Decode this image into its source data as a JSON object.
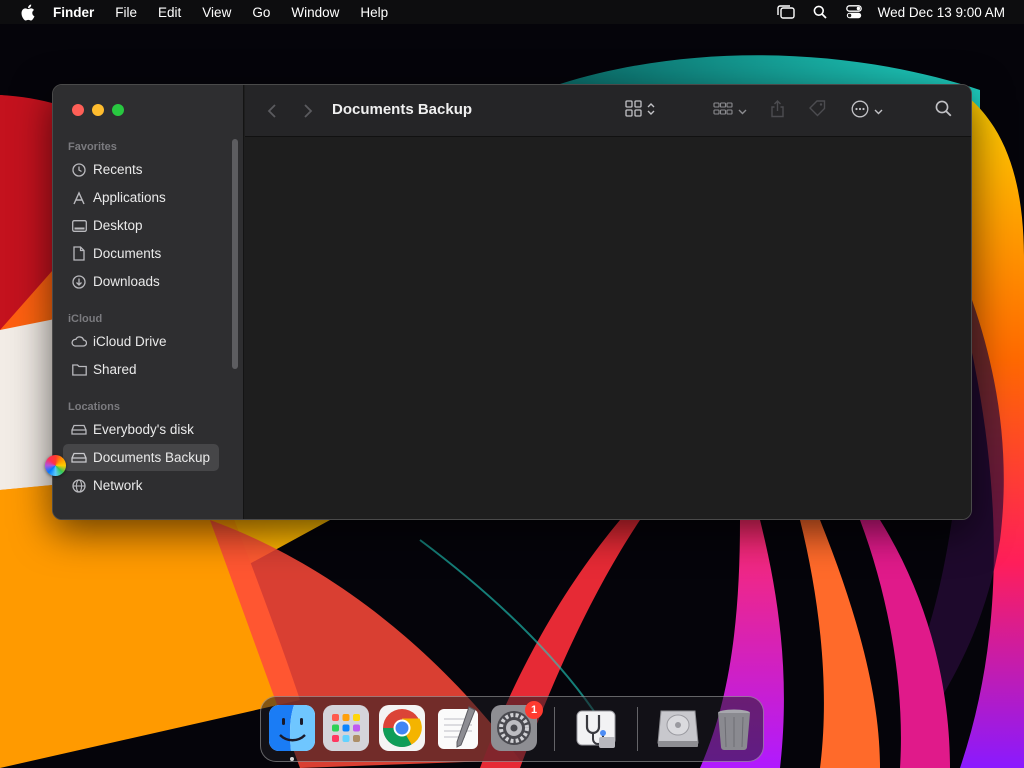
{
  "menubar": {
    "app_name": "Finder",
    "menus": [
      "File",
      "Edit",
      "View",
      "Go",
      "Window",
      "Help"
    ],
    "clock": "Wed Dec 13  9:00 AM"
  },
  "window": {
    "title": "Documents Backup",
    "sidebar": {
      "favorites_header": "Favorites",
      "favorites": [
        "Recents",
        "Applications",
        "Desktop",
        "Documents",
        "Downloads"
      ],
      "icloud_header": "iCloud",
      "icloud": [
        "iCloud Drive",
        "Shared"
      ],
      "locations_header": "Locations",
      "locations": [
        "Everybody's disk",
        "Documents Backup",
        "Network"
      ],
      "selected": "Documents Backup"
    }
  },
  "dock": {
    "apps": [
      "finder-icon",
      "launchpad-icon",
      "chrome-icon",
      "textedit-icon",
      "system-settings-icon",
      "disk-utility-icon",
      "drive-icon",
      "trash-icon"
    ],
    "settings_badge": "1"
  },
  "colors": {
    "close": "#fe5f57",
    "minimize": "#febc2e",
    "maximize": "#28c840",
    "badge": "#ff3b30"
  }
}
